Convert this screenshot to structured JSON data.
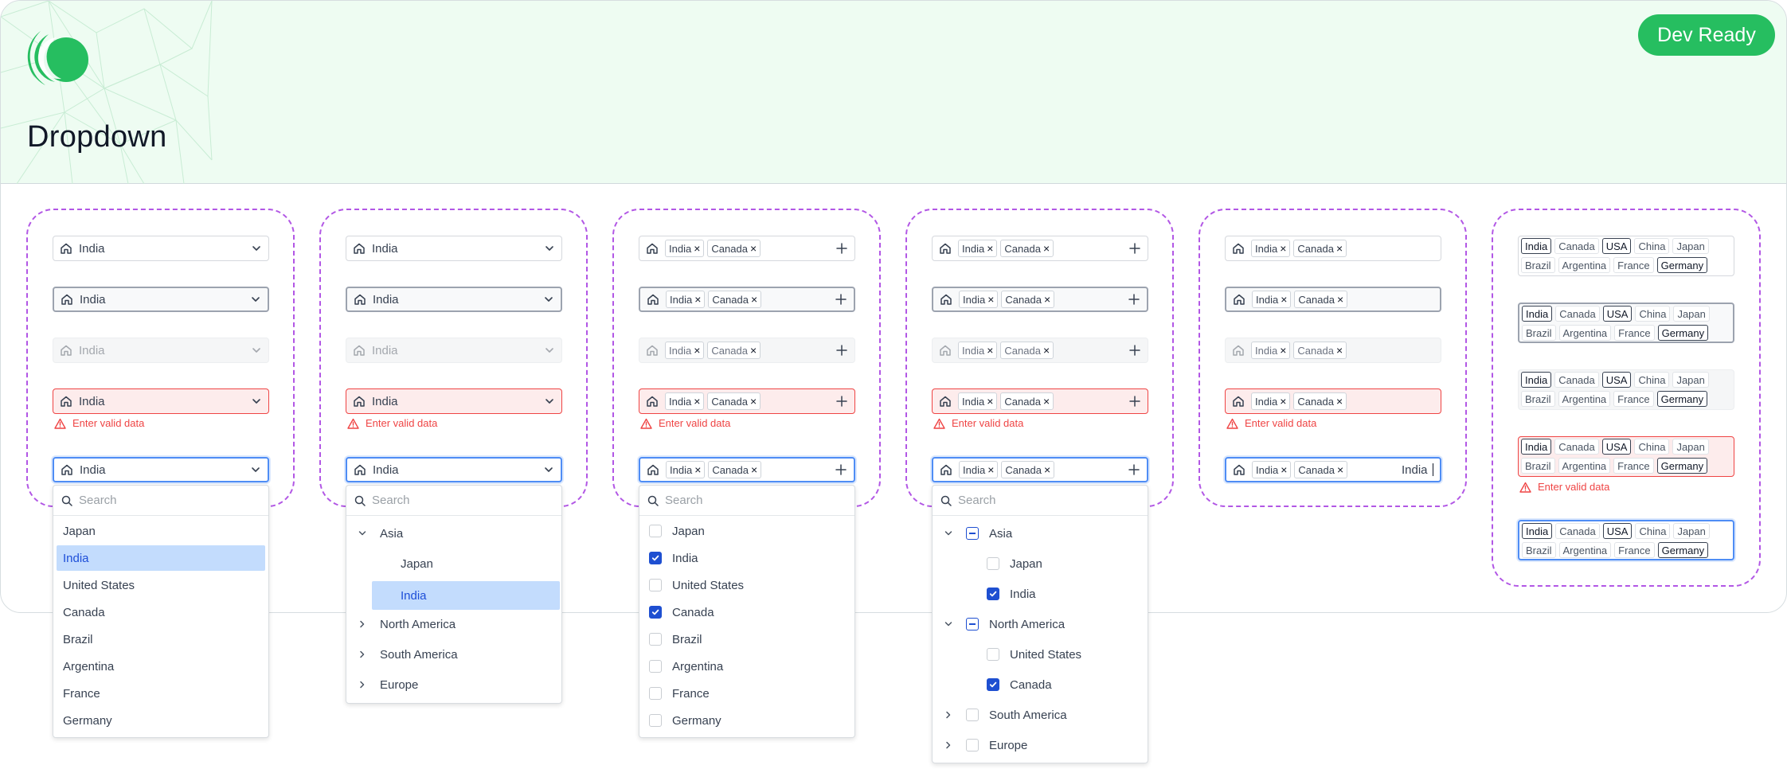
{
  "header": {
    "title": "Dropdown",
    "badge": "Dev Ready"
  },
  "field_value": "India",
  "chips": [
    "India",
    "Canada"
  ],
  "error_text": "Enter valid data",
  "search_placeholder": "Search",
  "typed_text": "India",
  "single_list": [
    "Japan",
    "India",
    "United States",
    "Canada",
    "Brazil",
    "Argentina",
    "France",
    "Germany"
  ],
  "tree": {
    "asia": "Asia",
    "japan": "Japan",
    "india": "India",
    "north_america": "North America",
    "united_states": "United States",
    "canada": "Canada",
    "south_america": "South America",
    "europe": "Europe"
  },
  "tags_row1": [
    "India",
    "Canada",
    "USA",
    "China",
    "Japan"
  ],
  "tags_row2": [
    "Brazil",
    "Argentina",
    "France",
    "Germany"
  ],
  "colors": {
    "accent": "#26be60",
    "header_bg": "#eefcf2",
    "focus": "#4f8df5",
    "error": "#ef4444",
    "selected": "#c3dcfd",
    "check": "#1e4fd1",
    "dashed": "#b257e5"
  }
}
